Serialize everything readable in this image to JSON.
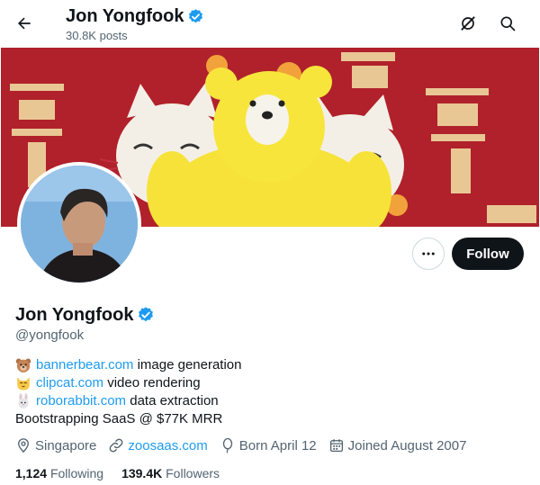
{
  "header": {
    "name": "Jon Yongfook",
    "posts": "30.8K posts"
  },
  "profile": {
    "name": "Jon Yongfook",
    "handle": "@yongfook",
    "follow_label": "Follow",
    "verified": true,
    "accent_color": "#1d9bf0"
  },
  "bio": [
    {
      "emoji": "bear-emoji",
      "link": "bannerbear.com",
      "text": " image generation"
    },
    {
      "emoji": "cat-emoji",
      "link": "clipcat.com",
      "text": " video rendering"
    },
    {
      "emoji": "rabbit-emoji",
      "link": "roborabbit.com",
      "text": " data extraction"
    }
  ],
  "bio_tagline": "Bootstrapping SaaS @ $77K MRR",
  "meta": {
    "location": "Singapore",
    "website": "zoosaas.com",
    "born": "Born April 12",
    "joined": "Joined August 2007"
  },
  "stats": {
    "following_count": "1,124",
    "following_label": "Following",
    "followers_count": "139.4K",
    "followers_label": "Followers"
  }
}
